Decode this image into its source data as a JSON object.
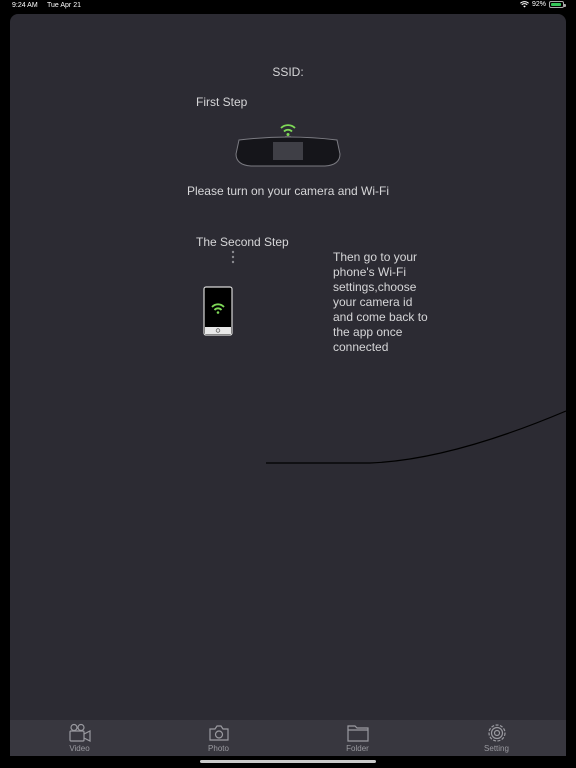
{
  "status": {
    "time": "9:24 AM",
    "date": "Tue Apr 21",
    "battery": "92%"
  },
  "main": {
    "ssid_label": "SSID:",
    "first_step": "First Step",
    "first_instruction": "Please turn on your camera and Wi-Fi",
    "second_step": "The Second Step",
    "second_instruction": "Then go to your phone's Wi-Fi settings,choose your camera id and come back to the app once connected"
  },
  "tabs": [
    {
      "label": "Video",
      "icon": "video-camera-icon"
    },
    {
      "label": "Photo",
      "icon": "camera-icon"
    },
    {
      "label": "Folder",
      "icon": "folder-icon"
    },
    {
      "label": "Setting",
      "icon": "gear-icon"
    }
  ],
  "colors": {
    "wifi_green": "#7ed957",
    "background": "#2c2b33",
    "tabbar": "#38373f"
  }
}
